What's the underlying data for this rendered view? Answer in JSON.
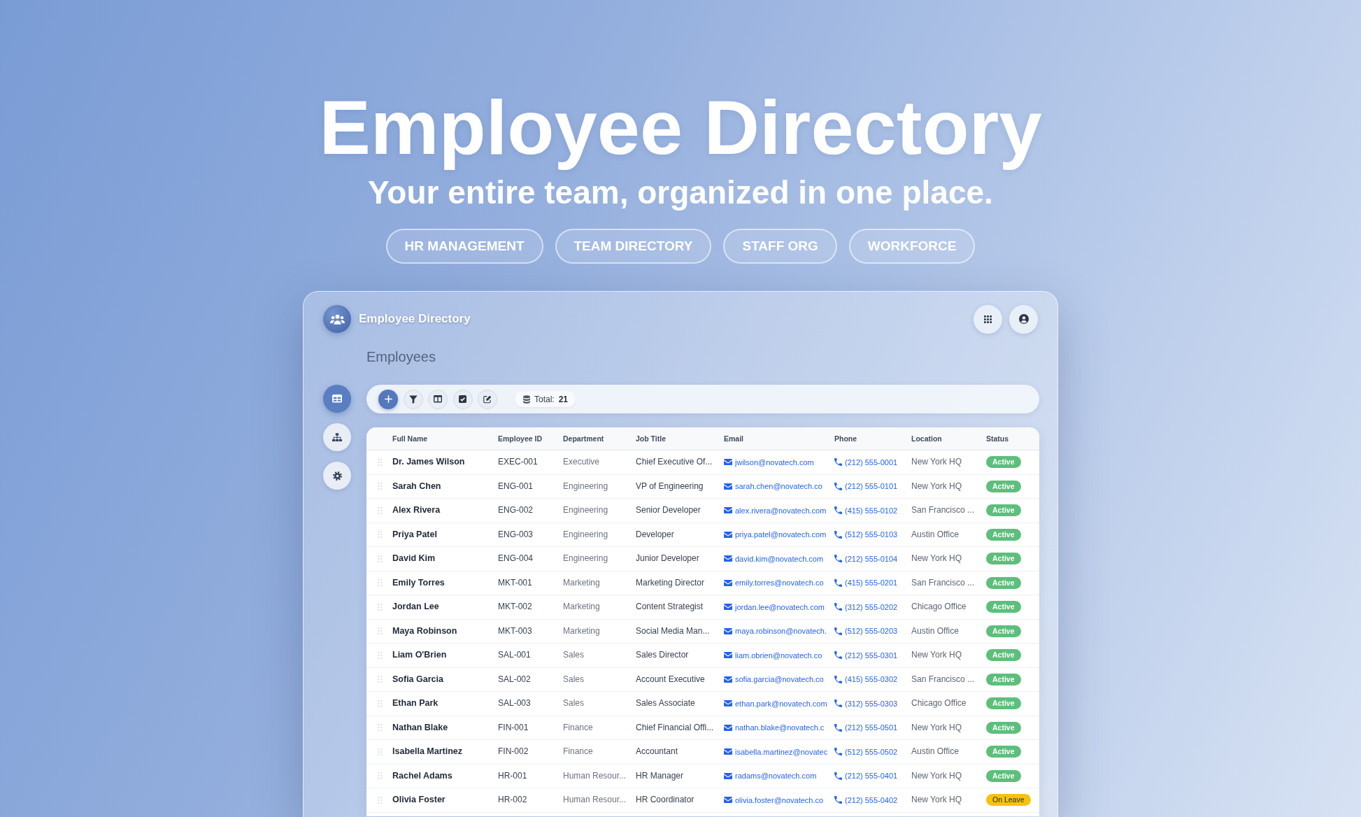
{
  "hero": {
    "title": "Employee Directory",
    "subtitle": "Your entire team, organized in one place.",
    "tags": [
      "HR MANAGEMENT",
      "TEAM DIRECTORY",
      "STAFF ORG",
      "WORKFORCE"
    ]
  },
  "app": {
    "title": "Employee Directory",
    "heading": "Employees",
    "sidebar": [
      {
        "kind": "table",
        "selected": true
      },
      {
        "kind": "org",
        "selected": false
      },
      {
        "kind": "settings",
        "selected": false
      }
    ],
    "toolbar": {
      "buttons": [
        {
          "kind": "add"
        },
        {
          "kind": "filter"
        },
        {
          "kind": "columns"
        },
        {
          "kind": "select"
        },
        {
          "kind": "edit"
        }
      ],
      "total_label": "Total:",
      "total_value": "21"
    },
    "table": {
      "columns": [
        "Full Name",
        "Employee ID",
        "Department",
        "Job Title",
        "Email",
        "Phone",
        "Location",
        "Status"
      ],
      "rows": [
        {
          "full_name": "Dr. James Wilson",
          "employee_id": "EXEC-001",
          "department": "Executive",
          "job_title": "Chief Executive Of...",
          "email": "jwilson@novatech.com",
          "phone": "(212) 555-0001",
          "location": "New York HQ",
          "status": {
            "label": "Active",
            "kind": "active"
          }
        },
        {
          "full_name": "Sarah Chen",
          "employee_id": "ENG-001",
          "department": "Engineering",
          "job_title": "VP of Engineering",
          "email": "sarah.chen@novatech.co",
          "phone": "(212) 555-0101",
          "location": "New York HQ",
          "status": {
            "label": "Active",
            "kind": "active"
          }
        },
        {
          "full_name": "Alex Rivera",
          "employee_id": "ENG-002",
          "department": "Engineering",
          "job_title": "Senior Developer",
          "email": "alex.rivera@novatech.com",
          "phone": "(415) 555-0102",
          "location": "San Francisco ...",
          "status": {
            "label": "Active",
            "kind": "active"
          }
        },
        {
          "full_name": "Priya Patel",
          "employee_id": "ENG-003",
          "department": "Engineering",
          "job_title": "Developer",
          "email": "priya.patel@novatech.com",
          "phone": "(512) 555-0103",
          "location": "Austin Office",
          "status": {
            "label": "Active",
            "kind": "active"
          }
        },
        {
          "full_name": "David Kim",
          "employee_id": "ENG-004",
          "department": "Engineering",
          "job_title": "Junior Developer",
          "email": "david.kim@novatech.com",
          "phone": "(212) 555-0104",
          "location": "New York HQ",
          "status": {
            "label": "Active",
            "kind": "active"
          }
        },
        {
          "full_name": "Emily Torres",
          "employee_id": "MKT-001",
          "department": "Marketing",
          "job_title": "Marketing Director",
          "email": "emily.torres@novatech.co",
          "phone": "(415) 555-0201",
          "location": "San Francisco ...",
          "status": {
            "label": "Active",
            "kind": "active"
          }
        },
        {
          "full_name": "Jordan Lee",
          "employee_id": "MKT-002",
          "department": "Marketing",
          "job_title": "Content Strategist",
          "email": "jordan.lee@novatech.com",
          "phone": "(312) 555-0202",
          "location": "Chicago Office",
          "status": {
            "label": "Active",
            "kind": "active"
          }
        },
        {
          "full_name": "Maya Robinson",
          "employee_id": "MKT-003",
          "department": "Marketing",
          "job_title": "Social Media Man...",
          "email": "maya.robinson@novatech.",
          "phone": "(512) 555-0203",
          "location": "Austin Office",
          "status": {
            "label": "Active",
            "kind": "active"
          }
        },
        {
          "full_name": "Liam O'Brien",
          "employee_id": "SAL-001",
          "department": "Sales",
          "job_title": "Sales Director",
          "email": "liam.obrien@novatech.co",
          "phone": "(212) 555-0301",
          "location": "New York HQ",
          "status": {
            "label": "Active",
            "kind": "active"
          }
        },
        {
          "full_name": "Sofia Garcia",
          "employee_id": "SAL-002",
          "department": "Sales",
          "job_title": "Account Executive",
          "email": "sofia.garcia@novatech.co",
          "phone": "(415) 555-0302",
          "location": "San Francisco ...",
          "status": {
            "label": "Active",
            "kind": "active"
          }
        },
        {
          "full_name": "Ethan Park",
          "employee_id": "SAL-003",
          "department": "Sales",
          "job_title": "Sales Associate",
          "email": "ethan.park@novatech.com",
          "phone": "(312) 555-0303",
          "location": "Chicago Office",
          "status": {
            "label": "Active",
            "kind": "active"
          }
        },
        {
          "full_name": "Nathan Blake",
          "employee_id": "FIN-001",
          "department": "Finance",
          "job_title": "Chief Financial Offi...",
          "email": "nathan.blake@novatech.c",
          "phone": "(212) 555-0501",
          "location": "New York HQ",
          "status": {
            "label": "Active",
            "kind": "active"
          }
        },
        {
          "full_name": "Isabella Martinez",
          "employee_id": "FIN-002",
          "department": "Finance",
          "job_title": "Accountant",
          "email": "isabella.martinez@novatec",
          "phone": "(512) 555-0502",
          "location": "Austin Office",
          "status": {
            "label": "Active",
            "kind": "active"
          }
        },
        {
          "full_name": "Rachel Adams",
          "employee_id": "HR-001",
          "department": "Human Resour...",
          "job_title": "HR Manager",
          "email": "radams@novatech.com",
          "phone": "(212) 555-0401",
          "location": "New York HQ",
          "status": {
            "label": "Active",
            "kind": "active"
          }
        },
        {
          "full_name": "Olivia Foster",
          "employee_id": "HR-002",
          "department": "Human Resour...",
          "job_title": "HR Coordinator",
          "email": "olivia.foster@novatech.co",
          "phone": "(212) 555-0402",
          "location": "New York HQ",
          "status": {
            "label": "On Leave",
            "kind": "leave"
          }
        }
      ]
    }
  }
}
